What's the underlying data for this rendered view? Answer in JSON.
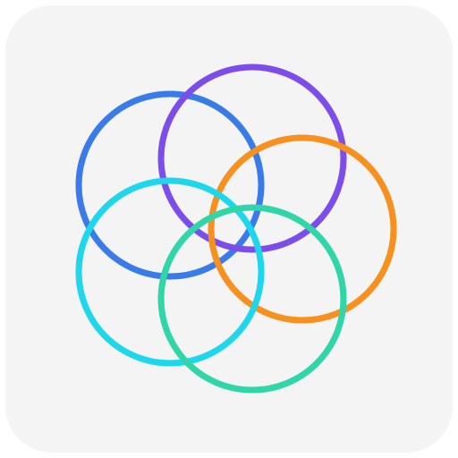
{
  "icon": {
    "name": "overlapping-rings-app-icon",
    "background_color": "#f4f4f4",
    "rings": [
      {
        "name": "blue-ring",
        "color": "#3a7bea"
      },
      {
        "name": "purple-ring",
        "color": "#7c4deb"
      },
      {
        "name": "orange-ring",
        "color": "#f7901e"
      },
      {
        "name": "cyan-ring",
        "color": "#1fd7ec"
      },
      {
        "name": "green-ring",
        "color": "#30d6a8"
      }
    ]
  }
}
